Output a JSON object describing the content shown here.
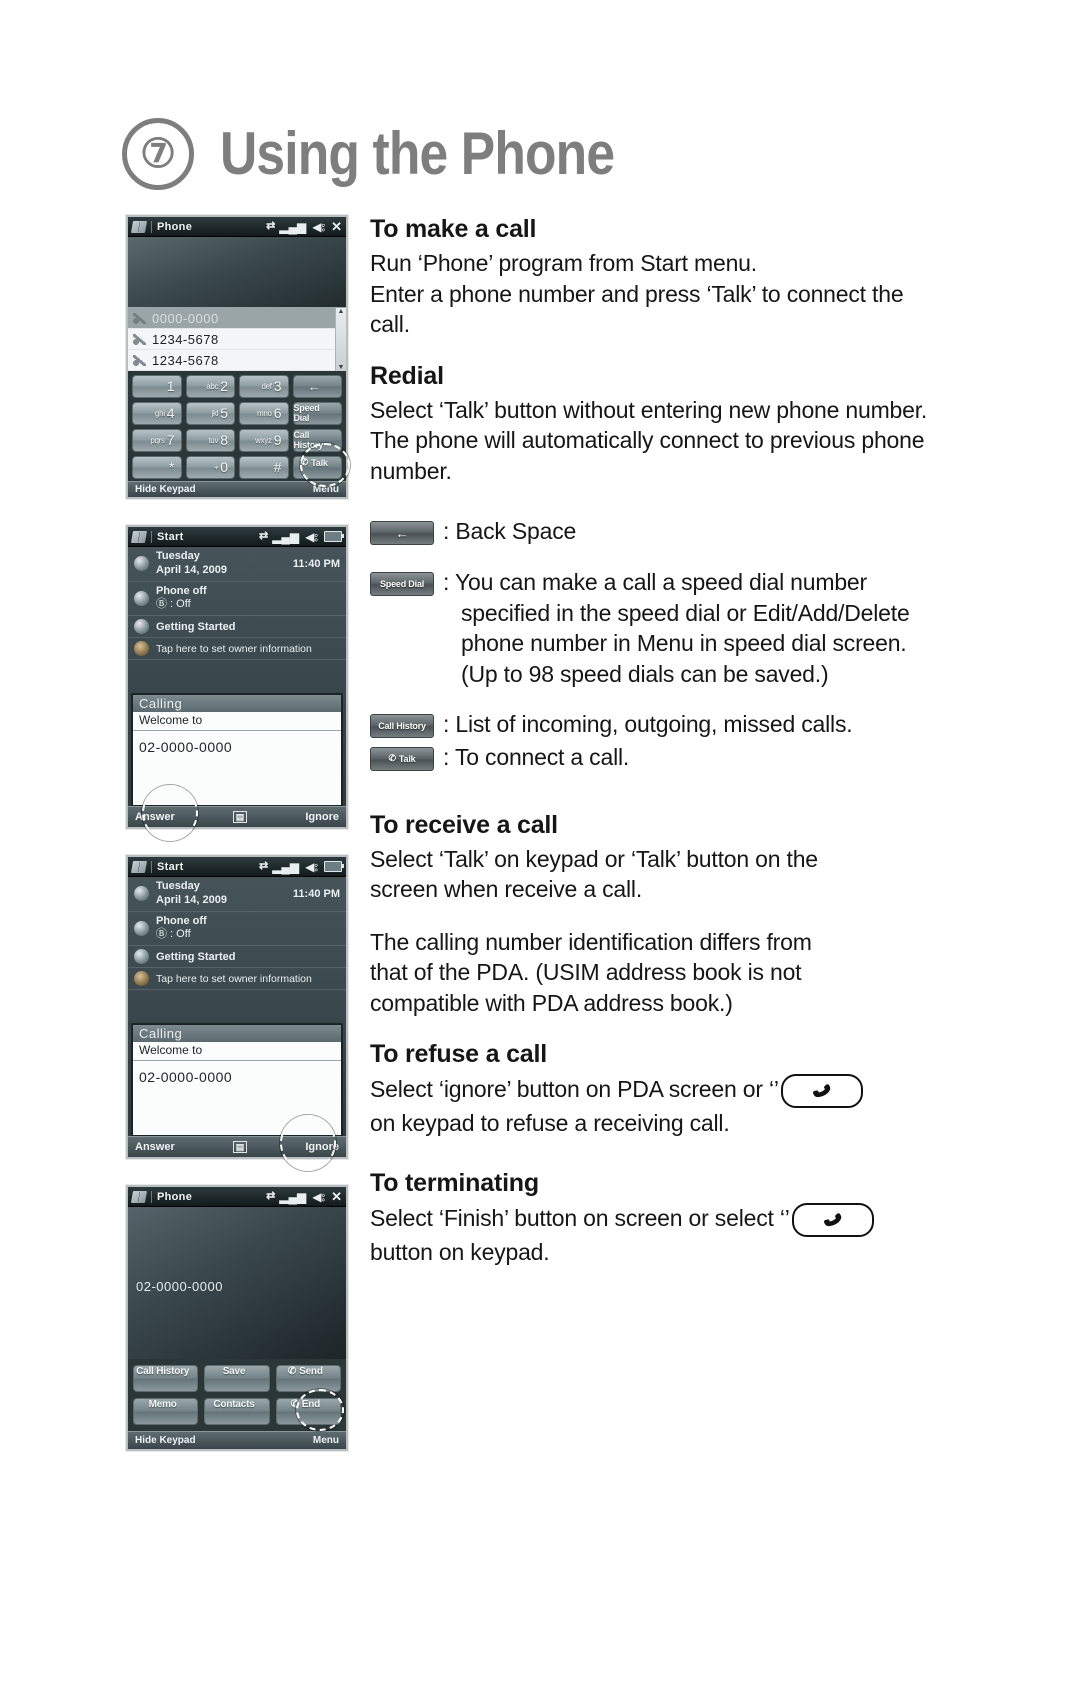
{
  "header": {
    "chapter_number": "⑦",
    "title": "Using the Phone"
  },
  "shots": {
    "phone_keypad": {
      "titlebar": {
        "title": "Phone",
        "icons": [
          "connectivity-icon",
          "signal-icon",
          "speaker-icon",
          "close-icon"
        ]
      },
      "call_list": [
        {
          "number": "0000-0000",
          "selected": true
        },
        {
          "number": "1234-5678",
          "selected": false
        },
        {
          "number": "1234-5678",
          "selected": false
        }
      ],
      "keys": [
        {
          "small": "",
          "big": "1"
        },
        {
          "small": "abc",
          "big": "2"
        },
        {
          "small": "def",
          "big": "3"
        },
        {
          "fn": true,
          "label": "←",
          "name": "backspace"
        },
        {
          "small": "ghi",
          "big": "4"
        },
        {
          "small": "jkl",
          "big": "5"
        },
        {
          "small": "mno",
          "big": "6"
        },
        {
          "fn": true,
          "label": "Speed Dial",
          "name": "speed-dial"
        },
        {
          "small": "pqrs",
          "big": "7"
        },
        {
          "small": "tuv",
          "big": "8"
        },
        {
          "small": "wxyz",
          "big": "9"
        },
        {
          "fn": true,
          "label": "Call History",
          "name": "call-history"
        },
        {
          "small": "",
          "big": "*"
        },
        {
          "small": "+",
          "big": "0"
        },
        {
          "small": "",
          "big": "#"
        },
        {
          "fn": true,
          "label": "Talk",
          "name": "talk",
          "phone_icon": true,
          "highlighted": true
        }
      ],
      "softbar": {
        "left": "Hide Keypad",
        "right": "Menu"
      }
    },
    "today_incoming": {
      "titlebar": {
        "title": "Start"
      },
      "rows": [
        {
          "title": "Tuesday",
          "subtitle": "April 14, 2009",
          "time": "11:40 PM",
          "icon": "clock-icon"
        },
        {
          "title": "Phone off",
          "subtitle": "Ⓑ : Off",
          "icon": "antenna-icon"
        },
        {
          "title": "Getting Started",
          "icon": "globe-icon"
        },
        {
          "title": "Tap here to set owner information",
          "icon": "owner-icon",
          "plain": true
        }
      ],
      "dialog": {
        "header": "Calling",
        "subtitle": "Welcome to",
        "number": "02-0000-0000"
      },
      "softbar": {
        "left": "Answer",
        "middle": "keyboard-icon",
        "right": "Ignore"
      },
      "highlight": "answer"
    },
    "today_refuse": {
      "titlebar": {
        "title": "Start"
      },
      "rows": [
        {
          "title": "Tuesday",
          "subtitle": "April 14, 2009",
          "time": "11:40 PM",
          "icon": "clock-icon"
        },
        {
          "title": "Phone off",
          "subtitle": "Ⓑ : Off",
          "icon": "antenna-icon"
        },
        {
          "title": "Getting Started",
          "icon": "globe-icon"
        },
        {
          "title": "Tap here to set owner information",
          "icon": "owner-icon",
          "plain": true
        }
      ],
      "dialog": {
        "header": "Calling",
        "subtitle": "Welcome to",
        "number": "02-0000-0000"
      },
      "softbar": {
        "left": "Answer",
        "middle": "keyboard-icon",
        "right": "Ignore"
      },
      "highlight": "ignore"
    },
    "in_call": {
      "titlebar": {
        "title": "Phone"
      },
      "number": "02-0000-0000",
      "buttons": [
        {
          "label": "Call History",
          "name": "call-history"
        },
        {
          "label": "Save",
          "name": "save"
        },
        {
          "label": "Send",
          "name": "send",
          "phone_icon": true
        },
        {
          "label": "Memo",
          "name": "memo"
        },
        {
          "label": "Contacts",
          "name": "contacts"
        },
        {
          "label": "End",
          "name": "end",
          "phone_icon": true,
          "highlighted": true
        }
      ],
      "softbar": {
        "left": "Hide Keypad",
        "right": "Menu"
      }
    }
  },
  "content": {
    "make_a_call": {
      "heading": "To make a call",
      "line1": "Run ‘Phone’ program from Start menu.",
      "line2": "Enter a phone number and press ‘Talk’ to connect the call."
    },
    "redial": {
      "heading": "Redial",
      "line1": "Select ‘Talk’ button without entering new phone number.",
      "line2": "The phone will automatically connect to previous phone",
      "line3": "number."
    },
    "legend": [
      {
        "chip": "←",
        "chip_name": "backspace-chip",
        "text": ": Back Space"
      },
      {
        "chip": "Speed Dial",
        "chip_name": "speed-dial-chip",
        "text": ": You can make a call a speed dial number",
        "indent1": "specified in the speed dial or Edit/Add/Delete",
        "indent2": "phone number in Menu in speed dial screen.",
        "indent3": "(Up to 98 speed dials can be saved.)"
      },
      {
        "chip": "Call History",
        "chip_name": "call-history-chip",
        "text": ": List of incoming, outgoing, missed calls."
      },
      {
        "chip": "Talk",
        "chip_name": "talk-chip",
        "text": ": To connect a call."
      }
    ],
    "receive_a_call": {
      "heading": "To receive a call",
      "line1": "Select ‘Talk’ on keypad or ‘Talk’ button on the",
      "line2": "screen when receive a call.",
      "note1": "The calling number identification differs from",
      "note2": "that of the PDA. (USIM address book is not",
      "note3": "compatible with PDA address book.)"
    },
    "refuse_a_call": {
      "heading": "To refuse a call",
      "line1_a": "Select ‘ignore’ button on PDA screen or ‘’",
      "line2": "on keypad to refuse a receiving call."
    },
    "terminating": {
      "heading": "To terminating",
      "line1_a": "Select ‘Finish’ button on screen or select ‘’",
      "line2": "button on keypad."
    }
  }
}
